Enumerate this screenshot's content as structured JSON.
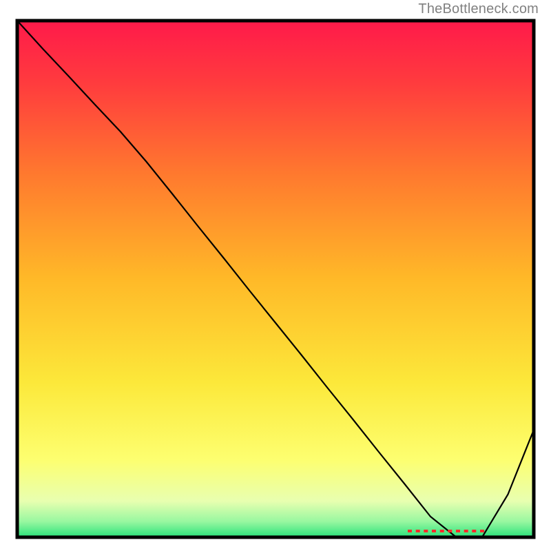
{
  "watermark": "TheBottleneck.com",
  "chart_data": {
    "type": "line",
    "title": "",
    "xlabel": "",
    "ylabel": "",
    "x": [
      0.0,
      0.05,
      0.1,
      0.15,
      0.2,
      0.25,
      0.3,
      0.35,
      0.4,
      0.45,
      0.5,
      0.55,
      0.6,
      0.65,
      0.7,
      0.75,
      0.8,
      0.85,
      0.9,
      0.95,
      1.0
    ],
    "y": [
      1.0,
      0.945,
      0.892,
      0.838,
      0.785,
      0.727,
      0.665,
      0.602,
      0.54,
      0.477,
      0.415,
      0.353,
      0.29,
      0.228,
      0.165,
      0.103,
      0.04,
      0.0,
      0.0,
      0.083,
      0.208
    ],
    "xlim": [
      0,
      1
    ],
    "ylim": [
      0,
      1
    ],
    "gradient_stops": [
      {
        "offset": 0.0,
        "color": "#ff1a4a"
      },
      {
        "offset": 0.12,
        "color": "#ff3b3e"
      },
      {
        "offset": 0.3,
        "color": "#ff7a2e"
      },
      {
        "offset": 0.5,
        "color": "#ffb928"
      },
      {
        "offset": 0.7,
        "color": "#fce83a"
      },
      {
        "offset": 0.85,
        "color": "#fdff70"
      },
      {
        "offset": 0.93,
        "color": "#e8ffb0"
      },
      {
        "offset": 0.97,
        "color": "#97f7a0"
      },
      {
        "offset": 1.0,
        "color": "#29e27a"
      }
    ],
    "line_color": "#000000",
    "border_color": "#000000",
    "annotation": {
      "text_color": "#ff2a2a",
      "x0": 0.76,
      "x1": 0.9,
      "y": 0.012
    }
  }
}
